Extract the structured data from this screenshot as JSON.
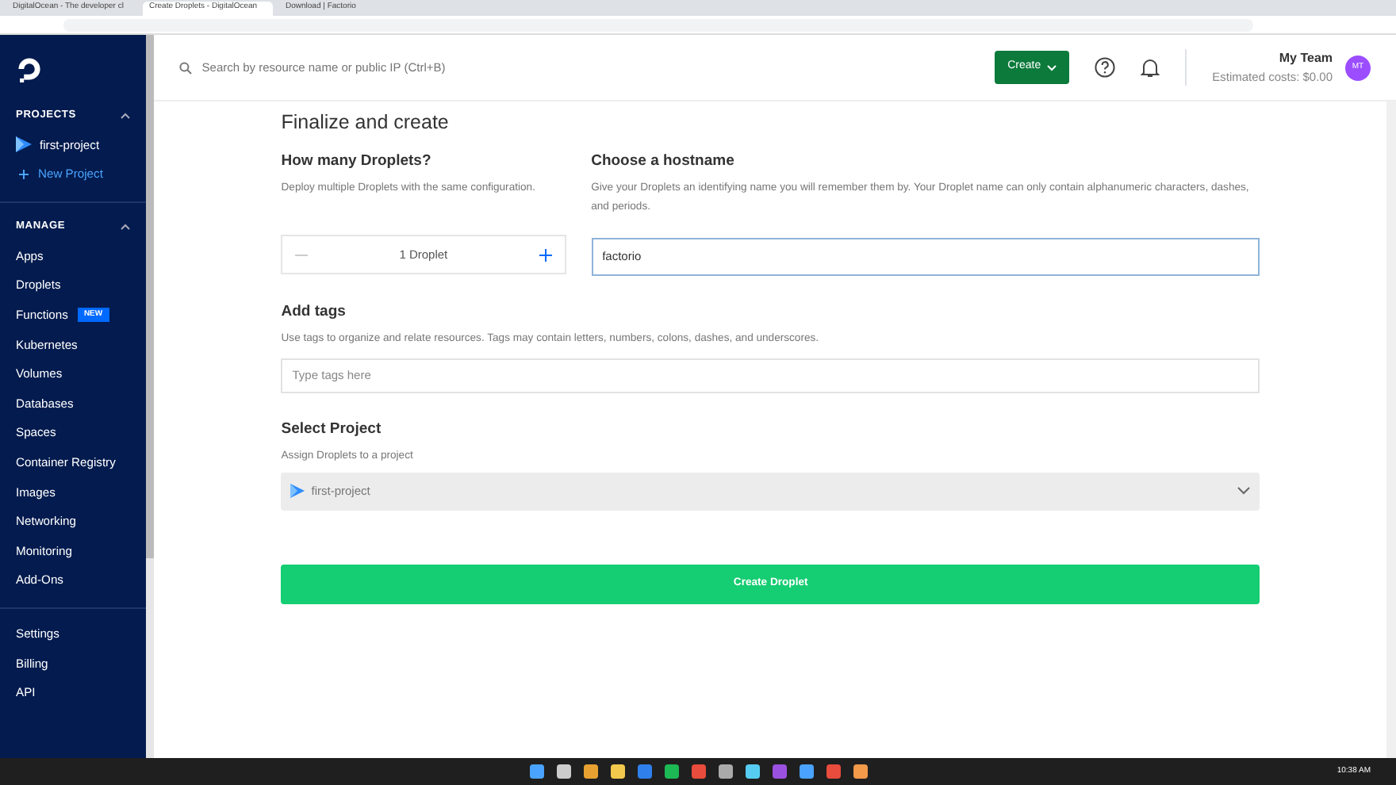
{
  "browser": {
    "tabs": [
      {
        "title": "DigitalOcean - The developer cl",
        "selected": false
      },
      {
        "title": "Create Droplets - DigitalOcean",
        "selected": true
      },
      {
        "title": "Download | Factorio",
        "selected": false
      }
    ]
  },
  "sidebar": {
    "sections": [
      {
        "title": "PROJECTS",
        "expanded": true,
        "items": [
          {
            "label": "first-project",
            "kind": "project"
          },
          {
            "label": "New Project",
            "kind": "add"
          }
        ]
      },
      {
        "title": "MANAGE",
        "expanded": true,
        "items": [
          {
            "label": "Apps",
            "kind": "link"
          },
          {
            "label": "Droplets",
            "kind": "link"
          },
          {
            "label": "Functions",
            "kind": "link",
            "badge": "NEW"
          },
          {
            "label": "Kubernetes",
            "kind": "link"
          },
          {
            "label": "Volumes",
            "kind": "link"
          },
          {
            "label": "Databases",
            "kind": "link"
          },
          {
            "label": "Spaces",
            "kind": "link"
          },
          {
            "label": "Container Registry",
            "kind": "link"
          },
          {
            "label": "Images",
            "kind": "link"
          },
          {
            "label": "Networking",
            "kind": "link"
          },
          {
            "label": "Monitoring",
            "kind": "link"
          },
          {
            "label": "Add-Ons",
            "kind": "link"
          }
        ]
      },
      {
        "items": [
          {
            "label": "Settings",
            "kind": "link"
          },
          {
            "label": "Billing",
            "kind": "link"
          },
          {
            "label": "API",
            "kind": "link"
          }
        ]
      }
    ]
  },
  "header": {
    "search": {
      "placeholder": "Search by resource name or public IP (Ctrl+B)"
    },
    "create_button": "Create",
    "team": "My Team",
    "costs": "Estimated costs: $0.00",
    "avatar": "MT"
  },
  "form": {
    "title": "Finalize and create",
    "droplets": {
      "heading": "How many Droplets?",
      "text_before": "Deploy multiple Droplets with the same ",
      "link": "configuration",
      "text_after": ".",
      "count": "1 Droplet",
      "minus_disabled": true
    },
    "hostname": {
      "heading": "Choose a hostname",
      "text": "Give your Droplets an identifying name you will remember them by. Your Droplet name can only contain alphanumeric characters, dashes, and periods.",
      "value": "factorio"
    },
    "tags": {
      "heading": "Add tags",
      "text": "Use tags to organize and relate resources. Tags may contain letters, numbers, colons, dashes, and underscores.",
      "placeholder": "Type tags here"
    },
    "project": {
      "heading": "Select Project",
      "text": "Assign Droplets to a project",
      "value": "first-project"
    },
    "submit": "Create Droplet"
  },
  "taskbar": {
    "time": "10:38 AM"
  }
}
